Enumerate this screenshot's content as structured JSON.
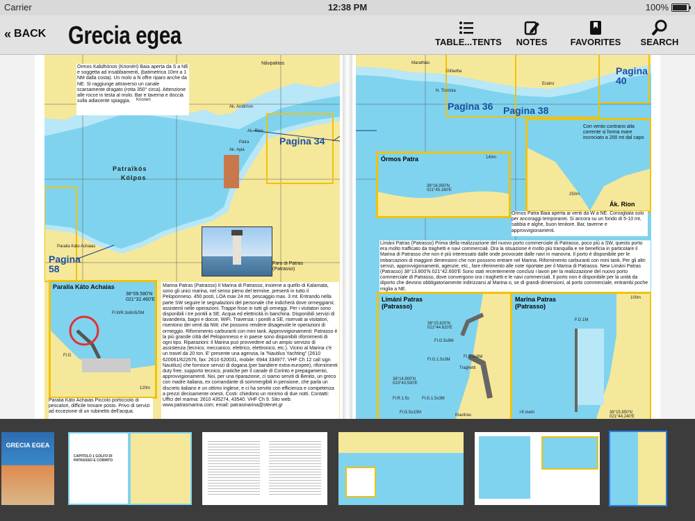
{
  "status_bar": {
    "carrier": "Carrier",
    "time": "12:38 PM",
    "battery": "100%"
  },
  "nav": {
    "back_label": "BACK",
    "title": "Grecia egea",
    "buttons": [
      {
        "label": "TABLE...TENTS",
        "icon": "list-icon"
      },
      {
        "label": "NOTES",
        "icon": "pencil-icon"
      },
      {
        "label": "FAVORITES",
        "icon": "bookmark-icon"
      },
      {
        "label": "SEARCH",
        "icon": "search-icon"
      }
    ]
  },
  "left_page": {
    "pagina_34": "Pagina 34",
    "pagina_58": "Pagina 58",
    "gulf_name_1": "Patraïkós",
    "gulf_name_2": "Kólpos",
    "places": {
      "navpaktos": "Návpaktos",
      "krioneri": "Krionéri",
      "patra": "Patra",
      "paralia_small": "Paralia Káto Achaias",
      "ak_andirrion": "Ak. Andirrion",
      "ak_rion": "Ak. Rion",
      "ak_ayia": "Ak. Ayia"
    },
    "ormos_text": "Órmos Kalidhónos (Krionéri) Baia aperta da S a NE e soggetta ad insabbiamenti, (batimetrica 10mt a 1 NM dalla costa). Un molo a N offre riparo anche da NE. Si raggiunge attraverso un canale scarsamente dragato (rotta 350° circa). Attenzione alle rocce in testa al molo. Bar e taverna e doccia sulla adiacente spiaggia.",
    "faro_caption": "Faro di Patras (Patrasso)",
    "inset_title": "Paralia Káto Achaias",
    "inset_coords": "38°09.580'N 021°32.460'E",
    "inset_light": "Fl.WR.3s8m5/3M",
    "inset_fl_g": "Fl.G",
    "inset_scale": "120m",
    "paralia_text": "Paralia Káto Achaias Piccolo porticciolo di pescatori, difficile trovare posto. Privo di servizi ad eccezione di un rubinetto dell'acqua.",
    "marina_text": "Marina Patras (Patrasso) Il Marina di Patrasso, insieme a quello di Kalamata, sono gli unici marina, nel senso pieno del termine, presenti in tutto il Peloponneso. 450 posti, LOA max 24 mt, pescaggio max. 3 mt. Entrando nella parte SW seguire le segnalazioni del personale che indicherà dove ormeggiarsi; assistenti nelle operazioni. Trappe fisse in tutti gli ormeggi. Per i visitatori sono disponibili i tre pontili a SE. Acqua ed elettricità in banchina. Disponibili servizi di lavanderia, bagni e docce, WiFi. Traversia: i pontili a SE, riservati ai visitatori, risentono dei venti da NW, che possono rendere disagevole le operazioni di ormeggio. Rifornimento carburanti con mini tank. Approvvigionamenti: Patrasso è la più grande città del Peloponneso e in paese sono disponibili rifornimenti di ogni tipo. Riparazioni: il Marina può provvedere ad un ampio servizio di assistenza (tecnico, meccanico, elettrico, elettronico, etc.). Vicino al Marina c'è un travel da 20 ton. E' presente una agenzia, la \"Nautilus Yachting\" (2610 620061/622676, fax: 2610 620031, mobile: 6944 334977, VHF Ch 12 call sign Nautilus) che fornisce servizi di dogana (per bandiere extra-europee), rifornimenti duty free, supporto tecnico, pratiche per il canale di Corinto e prepagamento, approvvigionamenti. Noi, per una riparazione, ci siamo serviti di Benito, un greco con madre italiana, ex comandante di sommergibili in pensione, che parla un discreto italiano e un ottimo inglese, e ci ha servito con efficienza e competenza a prezzi decisamente onesti. Costi: chiedono un minimo di due notti. Contatti: Uffici del marina: 2610 435274, 43540. VHF Ch 9. Sito web: www.patrasmarina.com; email: patrasmarina@otenet.gr"
  },
  "right_page": {
    "pagina_36": "Pagina 36",
    "pagina_38": "Pagina 38",
    "pagina_40": "Pagina 40",
    "places": {
      "marathias": "Marathiás",
      "glifadha": "Glifadha",
      "trizonia": "N. Trizónia",
      "eratini": "Eratini",
      "ak_rion": "Ák. Rion"
    },
    "ormos_patra_title": "Órmos Patra",
    "ormos_patra_coords": "38°16.950'N 021°45.160'E",
    "ormos_patra_scale": "140m",
    "rion_note": "Con vento contrario alla corrente si forma mare incrociato a 200 mt dal capo",
    "rion_scale": "250m",
    "ormos_text": "Órmos Patra Baia aperta ai venti da W a NE. Consigliata solo per ancoraggi temporanei. Si ancora su un fondo di 5-10 mt, sabbia e alghe, buon tenitore. Bar, taverne e approvvigionamenti.",
    "limani_text": "Limáni Patras (Patrasso) Prima della realizzazione del nuovo porto commerciale di Patrasso, poco più a SW, questo porto era molto trafficato da traghetti e navi commerciali. Ora la situazione è molto più tranquilla e ne beneficia in particolare il Marina di Patrasso che non è più interessato dalle onde provocate dalle navi in manovra. Il porto è disponibile per le imbarcazioni di maggiori dimensioni che non possono entrare nel Marina. Rifornimento carburanti con mini tank. Per gli altri servizi, approvvigionamenti, agenzie, etc., fare riferimento alle note riportate per il Marina di Patrasso. New Limáni Patras (Patrasso) 38°13.800'N 021°42.600'E Sono stati recentemente conclusi i lavori per la realizzazione del nuovo porto commerciale di Patrasso, dove convergono ora i traghetti e le navi commerciali. Il porto non è disponibile per la unità da diporto che devono obbligatoriamente indirizzarsi al Marina o, se di grandi dimensioni, al porto commerciale, entrambi poche miglia a NE.",
    "limani_inset_title": "Limáni Patras (Patrasso)",
    "limani_coords_1": "38°15.620'N 021°44.620'E",
    "limani_coords_2": "38°14.900'N 023°43.530'E",
    "limani_lights": [
      "Fl.G.5s8M",
      "Fl.G.1.5s3M",
      "Fl.R.5s8M",
      "Fl.R.1.5s",
      "Fl.G.1.5s3M",
      "Fl.G.5s10M"
    ],
    "traghetti": "Traghetti",
    "klavitras": "Klavitras",
    "marina_inset_title": "Marina Patras (Patrasso)",
    "marina_scale": "100m",
    "marina_depth": ">5 metri",
    "marina_fl": "F.G.1M",
    "marina_coords": "38°15.850'N 021°44.240'E"
  },
  "thumbnails": [
    {
      "label": "GRECIA EGEA",
      "kind": "cover"
    },
    {
      "label": "CAPITOLO 1 GOLFO DI PATRASSO E CORINTO",
      "kind": "chapter"
    },
    {
      "label": "",
      "kind": "text"
    },
    {
      "label": "",
      "kind": "map"
    },
    {
      "label": "",
      "kind": "map-insets"
    },
    {
      "label": "",
      "kind": "harbor"
    }
  ]
}
